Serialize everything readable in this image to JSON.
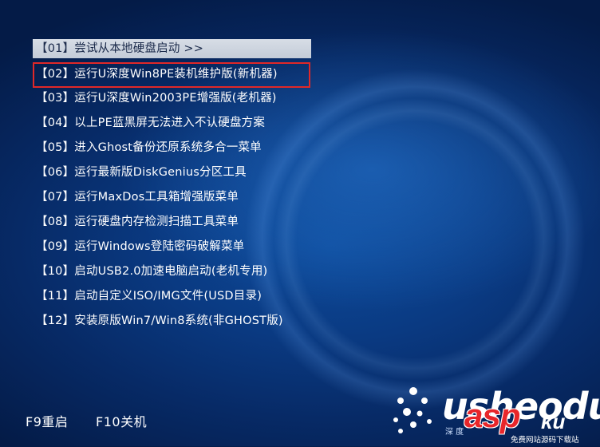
{
  "menu": {
    "items": [
      {
        "label": "【01】尝试从本地硬盘启动 >>"
      },
      {
        "label": "【02】运行U深度Win8PE装机维护版(新机器)"
      },
      {
        "label": "【03】运行U深度Win2003PE增强版(老机器)"
      },
      {
        "label": "【04】以上PE蓝黑屏无法进入不认硬盘方案"
      },
      {
        "label": "【05】进入Ghost备份还原系统多合一菜单"
      },
      {
        "label": "【06】运行最新版DiskGenius分区工具"
      },
      {
        "label": "【07】运行MaxDos工具箱增强版菜单"
      },
      {
        "label": "【08】运行硬盘内存检测扫描工具菜单"
      },
      {
        "label": "【09】运行Windows登陆密码破解菜单"
      },
      {
        "label": "【10】启动USB2.0加速电脑启动(老机专用)"
      },
      {
        "label": "【11】启动自定义ISO/IMG文件(USD目录)"
      },
      {
        "label": "【12】安装原版Win7/Win8系统(非GHOST版)"
      }
    ],
    "selected_index": 0,
    "highlighted_index": 1
  },
  "footer": {
    "f9": "F9重启",
    "f10": "F10关机"
  },
  "logo": {
    "text": "usheodu",
    "sub": "深 度"
  },
  "watermark": {
    "brand": "asp",
    "tld": "ku",
    "sub": "免费网站源码下载站"
  },
  "colors": {
    "background": "#0a3a82",
    "selected_bg": "#d0d7e2",
    "highlight_border": "#e02828",
    "watermark_red": "#e8262a"
  }
}
